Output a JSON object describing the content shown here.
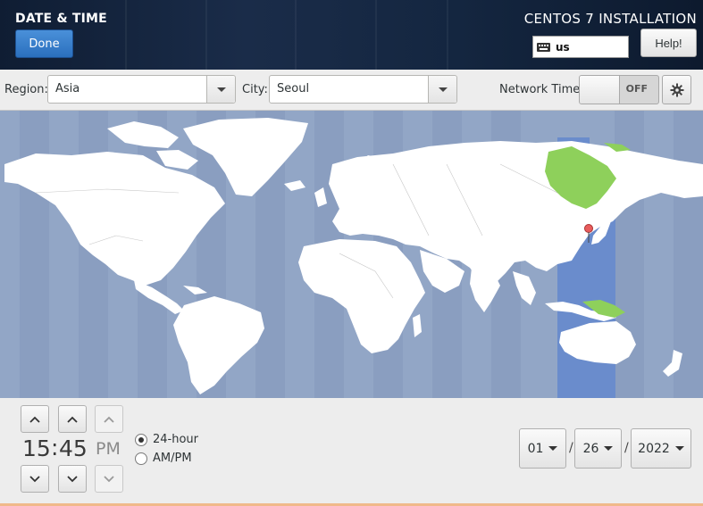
{
  "header": {
    "title": "DATE & TIME",
    "done_label": "Done",
    "install_title": "CENTOS 7 INSTALLATION",
    "keyboard_layout": "us",
    "help_label": "Help!"
  },
  "toolbar": {
    "region_label": "Region:",
    "region_value": "Asia",
    "city_label": "City:",
    "city_value": "Seoul",
    "network_time_label": "Network Time",
    "network_time_state": "OFF"
  },
  "map": {
    "ocean_color": "#92a6c6",
    "land_color": "#ffffff",
    "selected_zone_color": "#6a8ccc",
    "selected_country_color": "#8ed05b",
    "selected_city_marker": "pin-icon"
  },
  "time": {
    "hours": "15",
    "separator": ":",
    "minutes": "45",
    "ampm": "PM",
    "format_24h_label": "24-hour",
    "format_ampm_label": "AM/PM",
    "selected_format": "24-hour"
  },
  "date": {
    "month": "01",
    "day": "26",
    "year": "2022",
    "separator": "/"
  }
}
